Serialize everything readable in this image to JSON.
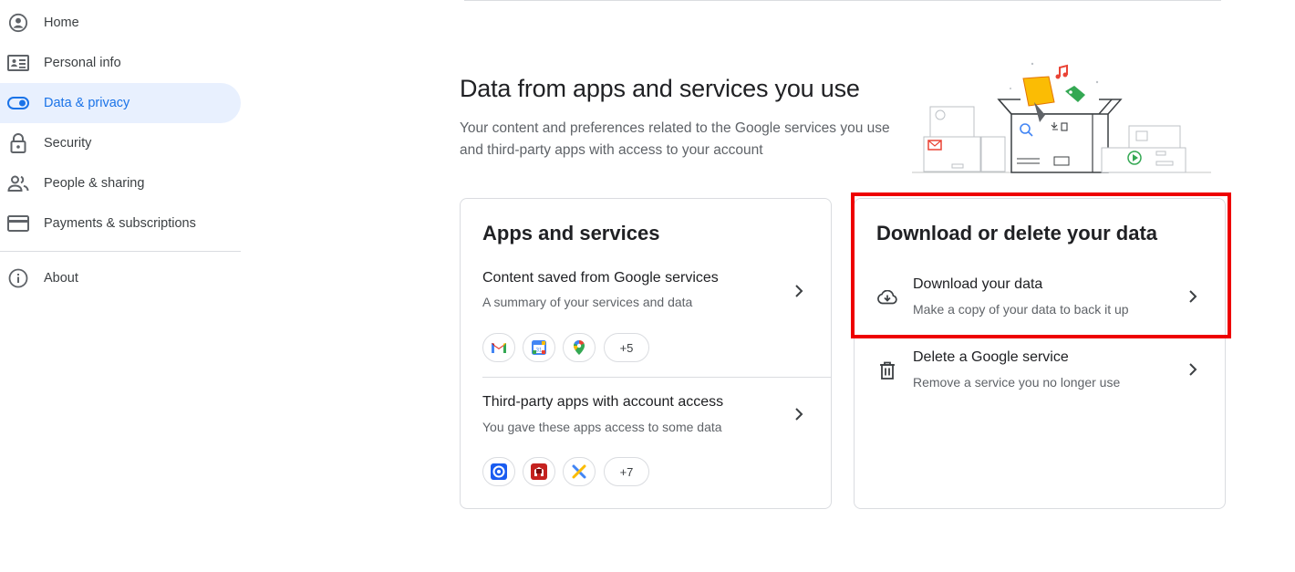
{
  "sidebar": {
    "items": [
      {
        "label": "Home",
        "icon": "account-circle-icon"
      },
      {
        "label": "Personal info",
        "icon": "id-card-icon"
      },
      {
        "label": "Data & privacy",
        "icon": "toggle-icon",
        "active": true
      },
      {
        "label": "Security",
        "icon": "lock-icon"
      },
      {
        "label": "People & sharing",
        "icon": "people-icon"
      },
      {
        "label": "Payments & subscriptions",
        "icon": "credit-card-icon"
      },
      {
        "label": "About",
        "icon": "info-icon"
      }
    ]
  },
  "section": {
    "title": "Data from apps and services you use",
    "description": "Your content and preferences related to the Google services you use and third-party apps with access to your account"
  },
  "apps_card": {
    "title": "Apps and services",
    "rows": [
      {
        "title": "Content saved from Google services",
        "subtitle": "A summary of your services and data",
        "chips": [
          "gmail-icon",
          "calendar-icon",
          "maps-icon"
        ],
        "more": "+5"
      },
      {
        "title": "Third-party apps with account access",
        "subtitle": "You gave these apps access to some data",
        "chips": [
          "app-target-icon",
          "app-red-icon",
          "app-x-icon"
        ],
        "more": "+7"
      }
    ]
  },
  "download_card": {
    "title": "Download or delete your data",
    "rows": [
      {
        "title": "Download your data",
        "subtitle": "Make a copy of your data to back it up",
        "icon": "cloud-download-icon"
      },
      {
        "title": "Delete a Google service",
        "subtitle": "Remove a service you no longer use",
        "icon": "trash-icon"
      }
    ]
  },
  "colors": {
    "accent": "#1a73e8",
    "active_bg": "#e8f0fe",
    "highlight": "#ee0000"
  }
}
